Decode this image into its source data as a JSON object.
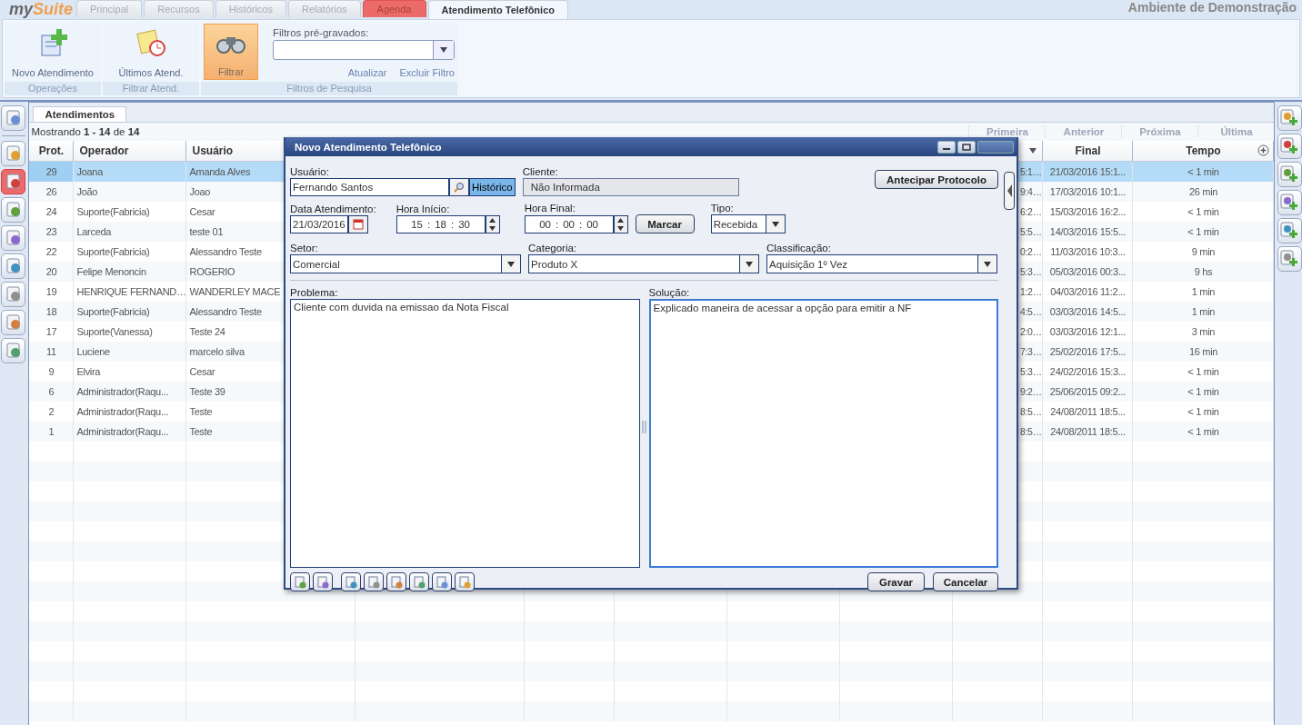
{
  "logo": {
    "part_1": "my",
    "part_2": "Suite"
  },
  "tabs": [
    {
      "label": "Principal",
      "selected": false,
      "alert": false
    },
    {
      "label": "Recursos",
      "selected": false,
      "alert": false
    },
    {
      "label": "Históricos",
      "selected": false,
      "alert": false
    },
    {
      "label": "Relatórios",
      "selected": false,
      "alert": false
    },
    {
      "label": "Agenda",
      "selected": false,
      "alert": true
    },
    {
      "label": "Atendimento Telefônico",
      "selected": true,
      "alert": false
    }
  ],
  "environment": "Ambiente de Demonstração",
  "ribbon": [
    {
      "group": "Operações",
      "buttons": [
        {
          "label": "Novo Atendimento",
          "active": false
        }
      ]
    },
    {
      "group": "Filtrar Atend.",
      "buttons": [
        {
          "label": "Últimos Atend.",
          "active": false
        }
      ]
    },
    {
      "group": "Filtros de Pesquisa",
      "buttons": [
        {
          "label": "Filtrar",
          "active": true
        }
      ],
      "filter": {
        "label": "Filtros pré-gravados:",
        "links": [
          "Atualizar",
          "Excluir Filtro"
        ]
      }
    }
  ],
  "left_toolbar": [
    {
      "selected": false
    },
    {
      "selected": false
    },
    {
      "selected": true
    },
    {
      "selected": false
    },
    {
      "selected": false
    },
    {
      "selected": false
    },
    {
      "selected": false
    },
    {
      "selected": false
    },
    {
      "selected": false
    }
  ],
  "right_toolbar": [
    {
      "selected": false
    },
    {
      "selected": false
    },
    {
      "selected": false
    },
    {
      "selected": false
    },
    {
      "selected": false
    },
    {
      "selected": false
    }
  ],
  "grid": {
    "tab": "Atendimentos",
    "summary": "Mostrando **1 - 14** de **14**",
    "pager": [
      {
        "label": "Primeira",
        "disabled": true
      },
      {
        "label": "Anterior",
        "disabled": true
      },
      {
        "label": "Próxima",
        "disabled": true
      },
      {
        "label": "Última",
        "disabled": true
      }
    ],
    "columns": [
      {
        "label": "Prot.",
        "sorted": false
      },
      {
        "label": "Operador",
        "sorted": false
      },
      {
        "label": "Usuário",
        "sorted": false
      },
      {
        "sorted": true
      },
      {
        "label": "Final",
        "sorted": false
      },
      {
        "label": "Tempo",
        "sorted": false
      }
    ],
    "rows": [
      {
        "cells": [
          "29",
          "Joana",
          "Amanda Alves",
          "5:1…",
          "21/03/2016 15:1...",
          "< 1 min"
        ],
        "selected": true
      },
      {
        "cells": [
          "26",
          "João",
          "Joao",
          "9:4…",
          "17/03/2016 10:1...",
          "26 min"
        ],
        "selected": false
      },
      {
        "cells": [
          "24",
          "Suporte(Fabricia)",
          "Cesar",
          "6:2…",
          "15/03/2016 16:2...",
          "< 1 min"
        ],
        "selected": false
      },
      {
        "cells": [
          "23",
          "Larceda",
          "teste 01",
          "5:5…",
          "14/03/2016 15:5...",
          "< 1 min"
        ],
        "selected": false
      },
      {
        "cells": [
          "22",
          "Suporte(Fabricia)",
          "Alessandro Teste",
          "0:2…",
          "11/03/2016 10:3...",
          "9 min"
        ],
        "selected": false
      },
      {
        "cells": [
          "20",
          "Felipe Menoncin",
          "ROGERIO",
          "5:3…",
          "05/03/2016 00:3...",
          "9 hs"
        ],
        "selected": false
      },
      {
        "cells": [
          "19",
          "HENRIQUE FERNAND…",
          "WANDERLEY MACE",
          "1:2…",
          "04/03/2016 11:2...",
          "1 min"
        ],
        "selected": false
      },
      {
        "cells": [
          "18",
          "Suporte(Fabricia)",
          "Alessandro Teste",
          "4:5…",
          "03/03/2016 14:5...",
          "1 min"
        ],
        "selected": false
      },
      {
        "cells": [
          "17",
          "Suporte(Vanessa)",
          "Teste 24",
          "2:0…",
          "03/03/2016 12:1...",
          "3 min"
        ],
        "selected": false
      },
      {
        "cells": [
          "11",
          "Luciene",
          "marcelo silva",
          "7:3…",
          "25/02/2016 17:5...",
          "16 min"
        ],
        "selected": false
      },
      {
        "cells": [
          "9",
          "Elvira",
          "Cesar",
          "5:3…",
          "24/02/2016 15:3...",
          "< 1 min"
        ],
        "selected": false
      },
      {
        "cells": [
          "6",
          "Administrador(Raqu...",
          "Teste 39",
          "9:2…",
          "25/06/2015 09:2...",
          "< 1 min"
        ],
        "selected": false
      },
      {
        "cells": [
          "2",
          "Administrador(Raqu...",
          "Teste",
          "8:5…",
          "24/08/2011 18:5...",
          "< 1 min"
        ],
        "selected": false
      },
      {
        "cells": [
          "1",
          "Administrador(Raqu...",
          "Teste",
          "8:5…",
          "24/08/2011 18:5...",
          "< 1 min"
        ],
        "selected": false
      }
    ]
  },
  "dialog": {
    "title": "Novo Atendimento Telefônico",
    "usuario": {
      "label": "Usuário:",
      "value": "Fernando Santos",
      "history_button": "Histórico"
    },
    "cliente": {
      "label": "Cliente:",
      "value": "Não Informada"
    },
    "protocol_button": "Antecipar Protocolo",
    "data": {
      "label": "Data Atendimento:",
      "value": "21/03/2016"
    },
    "hora_inicio": {
      "label": "Hora Início:",
      "hours": "15",
      "minutes": "18",
      "seconds": "30"
    },
    "hora_final": {
      "label": "Hora Final:",
      "hours": "00",
      "minutes": "00",
      "seconds": "00"
    },
    "time_separator": ":",
    "mark_button": "Marcar",
    "tipo": {
      "label": "Tipo:",
      "value": "Recebida"
    },
    "setor": {
      "label": "Setor:",
      "value": "Comercial"
    },
    "categoria": {
      "label": "Categoria:",
      "value": "Produto X"
    },
    "classificacao": {
      "label": "Classificação:",
      "value": "Aquisição 1º Vez"
    },
    "problema": {
      "label": "Problema:",
      "value": "Cliente com duvida na emissao da Nota Fiscal"
    },
    "solucao": {
      "label": "Solução:",
      "value": "Explicado maneira de acessar a opção para emitir a NF",
      "focused": true
    },
    "buttons": [
      "Gravar",
      "Cancelar"
    ]
  }
}
